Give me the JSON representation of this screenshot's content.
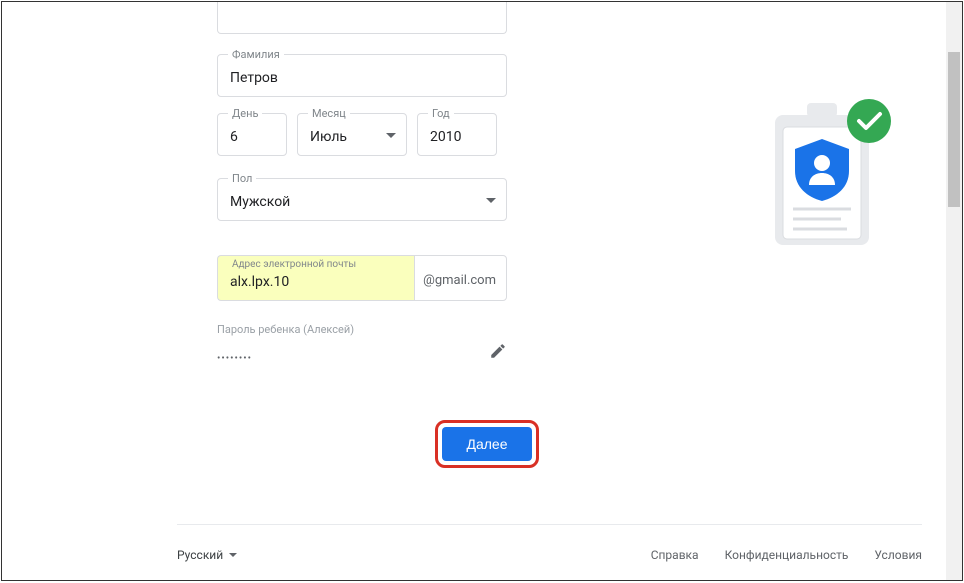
{
  "form": {
    "surname": {
      "label": "Фамилия",
      "value": "Петров"
    },
    "day": {
      "label": "День",
      "value": "6"
    },
    "month": {
      "label": "Месяц",
      "value": "Июль"
    },
    "year": {
      "label": "Год",
      "value": "2010"
    },
    "gender": {
      "label": "Пол",
      "value": "Мужской"
    },
    "email": {
      "label": "Адрес электронной почты",
      "value": "alx.lpx.10",
      "suffix": "@gmail.com"
    },
    "password": {
      "label": "Пароль ребенка (Алексей)",
      "masked": "••••••••"
    },
    "next_button": "Далее"
  },
  "footer": {
    "language": "Русский",
    "links": {
      "help": "Справка",
      "privacy": "Конфиденциальность",
      "terms": "Условия"
    }
  }
}
